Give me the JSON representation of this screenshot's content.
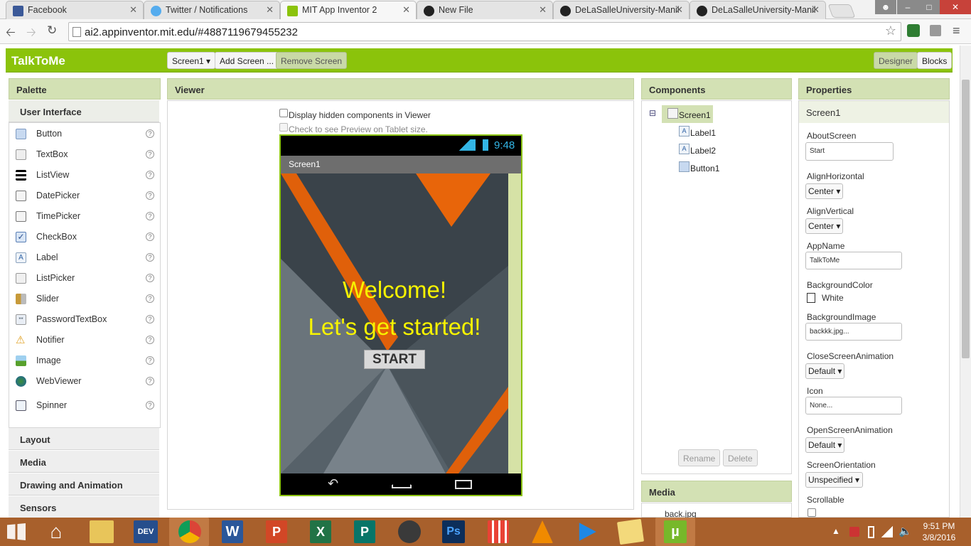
{
  "browser": {
    "tabs": [
      {
        "title": "Facebook",
        "icon": "facebook-icon"
      },
      {
        "title": "Twitter / Notifications",
        "icon": "twitter-icon"
      },
      {
        "title": "MIT App Inventor 2",
        "icon": "appinventor-icon"
      },
      {
        "title": "New File",
        "icon": "github-icon"
      },
      {
        "title": "DeLaSalleUniversity-Manil",
        "icon": "github-icon"
      },
      {
        "title": "DeLaSalleUniversity-Manil",
        "icon": "github-icon"
      }
    ],
    "url": "ai2.appinventor.mit.edu/#4887119679455232"
  },
  "app": {
    "project_name": "TalkToMe",
    "screen_select": "Screen1",
    "add_screen": "Add Screen ...",
    "remove_screen": "Remove Screen",
    "designer": "Designer",
    "blocks": "Blocks"
  },
  "palette": {
    "title": "Palette",
    "category": "User Interface",
    "items": [
      {
        "label": "Button",
        "icon": "button-icon"
      },
      {
        "label": "TextBox",
        "icon": "textbox-icon"
      },
      {
        "label": "ListView",
        "icon": "listview-icon"
      },
      {
        "label": "DatePicker",
        "icon": "datepicker-icon"
      },
      {
        "label": "TimePicker",
        "icon": "timepicker-icon"
      },
      {
        "label": "CheckBox",
        "icon": "checkbox-icon"
      },
      {
        "label": "Label",
        "icon": "label-icon"
      },
      {
        "label": "ListPicker",
        "icon": "listpicker-icon"
      },
      {
        "label": "Slider",
        "icon": "slider-icon"
      },
      {
        "label": "PasswordTextBox",
        "icon": "password-icon"
      },
      {
        "label": "Notifier",
        "icon": "notifier-icon"
      },
      {
        "label": "Image",
        "icon": "image-icon"
      },
      {
        "label": "WebViewer",
        "icon": "webviewer-icon"
      },
      {
        "label": "Spinner",
        "icon": "spinner-icon"
      }
    ],
    "categories": [
      "Layout",
      "Media",
      "Drawing and Animation",
      "Sensors"
    ],
    "help": "?"
  },
  "viewer": {
    "title": "Viewer",
    "hidden_components": "Display hidden components in Viewer",
    "tablet_preview": "Check to see Preview on Tablet size.",
    "phone": {
      "time": "9:48",
      "screen_title": "Screen1",
      "label1": "Welcome!",
      "label2": "Let's get started!",
      "button": "START"
    }
  },
  "components": {
    "title": "Components",
    "tree": [
      "Screen1",
      "Label1",
      "Label2",
      "Button1"
    ],
    "collapse": "⊟",
    "rename": "Rename",
    "delete": "Delete"
  },
  "media": {
    "title": "Media",
    "files": [
      "back.jpg"
    ]
  },
  "properties": {
    "title": "Properties",
    "component": "Screen1",
    "about_label": "AboutScreen",
    "about_value": "Start",
    "align_h_label": "AlignHorizontal",
    "align_h_value": "Center",
    "align_v_label": "AlignVertical",
    "align_v_value": "Center",
    "appname_label": "AppName",
    "appname_value": "TalkToMe",
    "bgcolor_label": "BackgroundColor",
    "bgcolor_value": "White",
    "bgimage_label": "BackgroundImage",
    "bgimage_value": "backkk.jpg...",
    "close_anim_label": "CloseScreenAnimation",
    "close_anim_value": "Default",
    "icon_label": "Icon",
    "icon_value": "None...",
    "open_anim_label": "OpenScreenAnimation",
    "open_anim_value": "Default",
    "orientation_label": "ScreenOrientation",
    "orientation_value": "Unspecified",
    "scrollable_label": "Scrollable"
  },
  "taskbar": {
    "time": "9:51 PM",
    "date": "3/8/2016"
  },
  "colors": {
    "brand_green": "#8bc30b",
    "panel_head": "#d3e1b4",
    "taskbar": "#a8602c",
    "label_yellow": "#f7f300"
  }
}
